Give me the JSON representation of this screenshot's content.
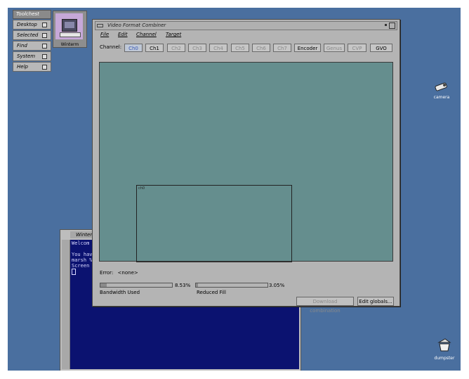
{
  "toolchest": {
    "title": "Toolchest",
    "items": [
      {
        "label": "Desktop"
      },
      {
        "label": "Selected"
      },
      {
        "label": "Find"
      },
      {
        "label": "System"
      },
      {
        "label": "Help"
      }
    ]
  },
  "desktop_icons": {
    "winterm": "Winterm",
    "camera": "camera",
    "dumpster": "dumpster"
  },
  "terminal": {
    "title": "Winter",
    "lines": [
      "Welcom",
      "",
      "You have",
      "marsh %",
      "Screen"
    ]
  },
  "window": {
    "title": "Video Format Combiner",
    "menus": [
      "File",
      "Edit",
      "Channel",
      "Target"
    ],
    "channel_label": "Channel:",
    "channels": [
      {
        "label": "Ch0",
        "state": "active"
      },
      {
        "label": "Ch1",
        "state": "enabled"
      },
      {
        "label": "Ch2",
        "state": "disabled"
      },
      {
        "label": "Ch3",
        "state": "disabled"
      },
      {
        "label": "Ch4",
        "state": "disabled"
      },
      {
        "label": "Ch5",
        "state": "disabled"
      },
      {
        "label": "Ch6",
        "state": "disabled"
      },
      {
        "label": "Ch7",
        "state": "disabled"
      },
      {
        "label": "Encoder",
        "state": "enabled"
      },
      {
        "label": "Genus",
        "state": "disabled"
      },
      {
        "label": "CVP",
        "state": "disabled"
      },
      {
        "label": "GVO",
        "state": "enabled"
      }
    ],
    "region_tag": "ch0",
    "error_label": "Error:",
    "error_value": "<none>",
    "bandwidth": {
      "label": "Bandwidth Used",
      "percent_text": "8.53%",
      "fraction": 0.0853
    },
    "reduced_fill": {
      "label": "Reduced Fill",
      "percent_text": "3.05%",
      "fraction": 0.0305
    },
    "buttons": {
      "download": "Download combination",
      "edit_globals": "Edit globals..."
    }
  },
  "colors": {
    "desktop": "#4a6f9f",
    "canvas": "#658e8e",
    "terminal_bg": "#0b1270",
    "active_channel": "#3a5ab8"
  }
}
